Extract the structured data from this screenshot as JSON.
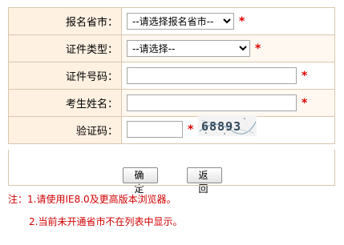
{
  "form": {
    "province": {
      "label": "报名省市：",
      "selected": "--请选择报名省市--",
      "required": "*"
    },
    "id_type": {
      "label": "证件类型：",
      "selected": "--请选择--",
      "required": "*"
    },
    "id_number": {
      "label": "证件号码：",
      "value": "",
      "required": "*"
    },
    "name": {
      "label": "考生姓名：",
      "value": "",
      "required": "*"
    },
    "captcha": {
      "label": "验证码：",
      "value": "",
      "required": "*",
      "image_text": "68893"
    }
  },
  "buttons": {
    "confirm": "确 定",
    "back": "返 回"
  },
  "notes": {
    "line1": "注：1.请使用IE8.0及更高版本浏览器。",
    "line2": "2.当前未开通省市不在列表中显示。"
  },
  "colors": {
    "label_bg": "#fff1e2",
    "border": "#d9c6ae",
    "required": "#e00000",
    "note": "#d00000"
  }
}
